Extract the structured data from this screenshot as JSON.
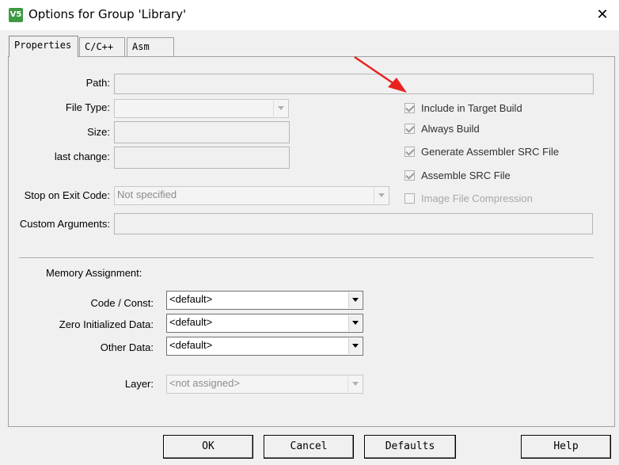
{
  "window": {
    "title": "Options for Group 'Library'",
    "app_icon_text": "V5",
    "close_label": "✕"
  },
  "tabs": [
    {
      "label": "Properties",
      "active": true
    },
    {
      "label": "C/C++",
      "active": false
    },
    {
      "label": "Asm",
      "active": false
    }
  ],
  "properties": {
    "path_label": "Path:",
    "file_type_label": "File Type:",
    "size_label": "Size:",
    "last_change_label": "last change:",
    "stop_on_exit_label": "Stop on Exit Code:",
    "stop_on_exit_value": "Not specified",
    "custom_args_label": "Custom Arguments:"
  },
  "options": [
    {
      "label": "Include in Target Build",
      "checked": true,
      "enabled": true
    },
    {
      "label": "Always Build",
      "checked": true,
      "enabled": true
    },
    {
      "label": "Generate Assembler SRC File",
      "checked": true,
      "enabled": true
    },
    {
      "label": "Assemble SRC File",
      "checked": true,
      "enabled": true
    },
    {
      "label": "Image File Compression",
      "checked": false,
      "enabled": false
    }
  ],
  "memory": {
    "heading": "Memory Assignment:",
    "code_const_label": "Code / Const:",
    "code_const_value": "<default>",
    "zero_init_label": "Zero Initialized Data:",
    "zero_init_value": "<default>",
    "other_data_label": "Other Data:",
    "other_data_value": "<default>",
    "layer_label": "Layer:",
    "layer_value": "<not assigned>"
  },
  "buttons": {
    "ok": "OK",
    "cancel": "Cancel",
    "defaults": "Defaults",
    "help": "Help"
  },
  "colors": {
    "annotation_arrow": "#e8231f",
    "dialog_bg": "#f0f0f0",
    "app_icon": "#3e9a42"
  }
}
